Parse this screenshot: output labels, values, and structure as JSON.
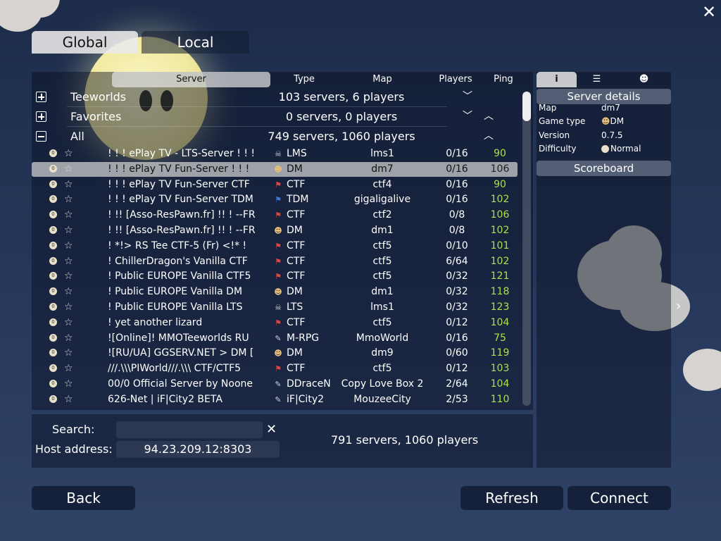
{
  "tabs": {
    "global": "Global",
    "local": "Local"
  },
  "columns": {
    "server": "Server",
    "type": "Type",
    "map": "Map",
    "players": "Players",
    "ping": "Ping"
  },
  "groups": [
    {
      "name": "Teeworlds",
      "stat": "103 servers, 6 players",
      "expanded": false
    },
    {
      "name": "Favorites",
      "stat": "0 servers, 0 players",
      "expanded": false
    },
    {
      "name": "All",
      "stat": "749 servers, 1060 players",
      "expanded": true
    }
  ],
  "rows": [
    {
      "name": "! ! ! ePlay TV - LTS-Server ! ! !",
      "type": "LMS",
      "type_icon": "skull-icon",
      "map": "lms1",
      "players": "0/16",
      "ping": "90",
      "selected": false
    },
    {
      "name": "! ! ! ePlay TV Fun-Server ! ! !",
      "type": "DM",
      "type_icon": "tee-icon",
      "map": "dm7",
      "players": "0/16",
      "ping": "106",
      "selected": true
    },
    {
      "name": "! ! ! ePlay TV Fun-Server CTF",
      "type": "CTF",
      "type_icon": "flag-icon",
      "map": "ctf4",
      "players": "0/16",
      "ping": "90",
      "selected": false
    },
    {
      "name": "! ! ! ePlay TV Fun-Server TDM",
      "type": "TDM",
      "type_icon": "tdm-icon",
      "map": "gigaligalive",
      "players": "0/16",
      "ping": "102",
      "selected": false
    },
    {
      "name": "! !! [Asso-ResPawn.fr] !! ! --FR",
      "type": "CTF",
      "type_icon": "flag-icon",
      "map": "ctf2",
      "players": "0/8",
      "ping": "106",
      "selected": false
    },
    {
      "name": "! !! [Asso-ResPawn.fr] !! ! --FR",
      "type": "DM",
      "type_icon": "tee-icon",
      "map": "dm1",
      "players": "0/8",
      "ping": "102",
      "selected": false
    },
    {
      "name": "! *!> RS Tee CTF-5 (Fr) <!* !",
      "type": "CTF",
      "type_icon": "flag-icon",
      "map": "ctf5",
      "players": "0/10",
      "ping": "101",
      "selected": false
    },
    {
      "name": "! ChillerDragon's Vanilla CTF",
      "type": "CTF",
      "type_icon": "flag-icon",
      "map": "ctf5",
      "players": "6/64",
      "ping": "102",
      "selected": false
    },
    {
      "name": "! Public EUROPE Vanilla CTF5",
      "type": "CTF",
      "type_icon": "flag-icon",
      "map": "ctf5",
      "players": "0/32",
      "ping": "121",
      "selected": false
    },
    {
      "name": "! Public EUROPE Vanilla DM",
      "type": "DM",
      "type_icon": "tee-icon",
      "map": "dm1",
      "players": "0/32",
      "ping": "118",
      "selected": false
    },
    {
      "name": "! Public EUROPE Vanilla LTS",
      "type": "LTS",
      "type_icon": "skull-icon",
      "map": "lms1",
      "players": "0/32",
      "ping": "123",
      "selected": false
    },
    {
      "name": "! yet another lizard",
      "type": "CTF",
      "type_icon": "flag-icon",
      "map": "ctf5",
      "players": "0/12",
      "ping": "104",
      "selected": false
    },
    {
      "name": "![Online]! MMOTeeworlds RU",
      "type": "M-RPG",
      "type_icon": "mod-icon",
      "map": "MmoWorld",
      "players": "0/16",
      "ping": "75",
      "selected": false
    },
    {
      "name": "![RU/UA] GGSERV.NET > DM [",
      "type": "DM",
      "type_icon": "tee-icon",
      "map": "dm9",
      "players": "0/60",
      "ping": "119",
      "selected": false
    },
    {
      "name": "///.\\\\\\PIWorld///.\\\\\\ CTF/CTF5",
      "type": "CTF",
      "type_icon": "flag-icon",
      "map": "ctf5",
      "players": "0/12",
      "ping": "103",
      "selected": false
    },
    {
      "name": "00/0 Official Server by Noone",
      "type": "DDraceN",
      "type_icon": "mod-icon",
      "map": "Copy Love Box 2",
      "players": "2/64",
      "ping": "104",
      "selected": false
    },
    {
      "name": "626-Net | iF|City2 BETA",
      "type": "iF|City2",
      "type_icon": "mod-icon",
      "map": "MouzeeCity",
      "players": "2/53",
      "ping": "110",
      "selected": false
    }
  ],
  "bottom": {
    "search_label": "Search:",
    "search_value": "",
    "host_label": "Host address:",
    "host_value": "94.23.209.12:8303",
    "summary": "791 servers, 1060 players"
  },
  "details": {
    "title": "Server details",
    "map_label": "Map",
    "map_value": "dm7",
    "gametype_label": "Game type",
    "gametype_value": "DM",
    "version_label": "Version",
    "version_value": "0.7.5",
    "difficulty_label": "Difficulty",
    "difficulty_value": "Normal",
    "scoreboard_title": "Scoreboard"
  },
  "buttons": {
    "back": "Back",
    "refresh": "Refresh",
    "connect": "Connect"
  },
  "colors": {
    "ping_good": "#a8e34a",
    "background": "#26385b"
  }
}
